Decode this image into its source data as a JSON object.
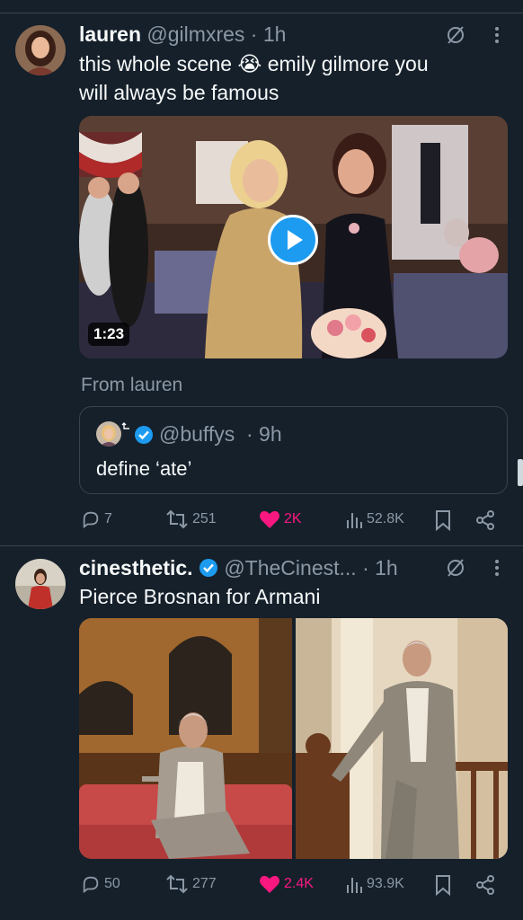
{
  "tweet1": {
    "name": "lauren",
    "handle": "@gilmxres",
    "time": "· 1h",
    "text_line1": "this whole scene 😭 emily gilmore you",
    "text_line2": "will always be famous",
    "video_duration": "1:23",
    "from_label": "From lauren",
    "quote": {
      "handle": "@buffys",
      "time": "· 9h",
      "text": "define ‘ate’"
    },
    "replies": "7",
    "retweets": "251",
    "likes": "2K",
    "views": "52.8K"
  },
  "tweet2": {
    "name": "cinesthetic.",
    "handle": "@TheCinest...",
    "time": "· 1h",
    "text": "Pierce Brosnan for Armani",
    "replies": "50",
    "retweets": "277",
    "likes": "2.4K",
    "views": "93.9K"
  },
  "colors": {
    "background": "#15202b",
    "secondary_text": "#8b98a5",
    "like_active": "#f91880",
    "verified": "#1d9bf0"
  },
  "icons": [
    "grok-icon",
    "more-icon",
    "play-icon",
    "reply-icon",
    "retweet-icon",
    "heart-icon",
    "views-icon",
    "bookmark-icon",
    "share-icon",
    "verified-icon"
  ]
}
